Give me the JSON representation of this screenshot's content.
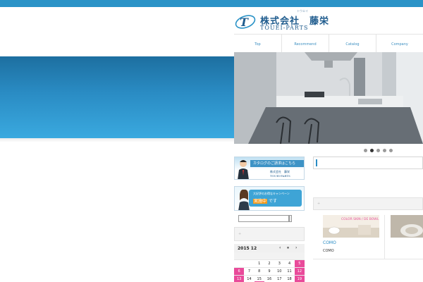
{
  "brand": {
    "name_jp": "株式会社　藤栄",
    "name_ruby": "トウエイ",
    "name_en": "TOUEI-PARTS",
    "accent_color": "#2b93c7"
  },
  "nav": {
    "items": [
      {
        "label": "Top"
      },
      {
        "label": "Recommend"
      },
      {
        "label": "Catalog"
      },
      {
        "label": "Company"
      }
    ]
  },
  "slider": {
    "slide_count": 5,
    "active_index": 1
  },
  "banners": {
    "catalog": {
      "headline": "カタログのご請求はこちら",
      "company_jp": "株式会社　藤栄",
      "company_en": "TOUEI-PARTS"
    },
    "campaign": {
      "headline": "大好評のお得なキャンペーン",
      "badge": "実施中",
      "suffix": "です"
    }
  },
  "search": {
    "value": "",
    "placeholder": ""
  },
  "calendar": {
    "title": "2015 12",
    "prev_label": "‹",
    "pause_label": "⏸",
    "next_label": "›",
    "rows": [
      [
        "",
        "",
        "1",
        "2",
        "3",
        "4",
        "5"
      ],
      [
        "6",
        "7",
        "8",
        "9",
        "10",
        "11",
        "12"
      ],
      [
        "13",
        "14",
        "15",
        "16",
        "17",
        "18",
        "19"
      ]
    ]
  },
  "products": [
    {
      "name": "COMO",
      "sub": "COMO",
      "thumb_text": "COLOR SKIN / DE BOWL"
    },
    {
      "name": "",
      "sub": "",
      "thumb_text": ""
    }
  ]
}
